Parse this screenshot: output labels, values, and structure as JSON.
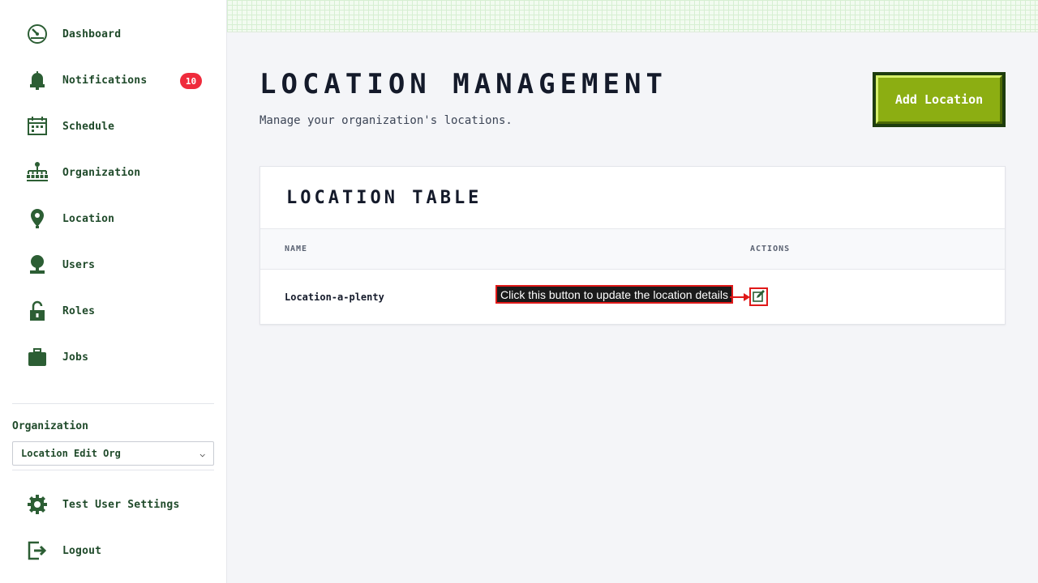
{
  "sidebar": {
    "nav": [
      {
        "label": "Dashboard",
        "icon": "dashboard-gauge-icon"
      },
      {
        "label": "Notifications",
        "icon": "bell-icon",
        "badge": "10"
      },
      {
        "label": "Schedule",
        "icon": "calendar-icon"
      },
      {
        "label": "Organization",
        "icon": "org-chart-icon"
      },
      {
        "label": "Location",
        "icon": "map-pin-icon"
      },
      {
        "label": "Users",
        "icon": "user-icon"
      },
      {
        "label": "Roles",
        "icon": "padlock-icon"
      },
      {
        "label": "Jobs",
        "icon": "briefcase-icon"
      }
    ],
    "organization_label": "Organization",
    "organization_selected": "Location Edit Org",
    "footer": [
      {
        "label": "Test User Settings",
        "icon": "gear-icon"
      },
      {
        "label": "Logout",
        "icon": "logout-icon"
      }
    ]
  },
  "main": {
    "title": "LOCATION MANAGEMENT",
    "subtitle": "Manage your organization's locations.",
    "add_button_label": "Add Location",
    "table": {
      "title": "LOCATION TABLE",
      "columns": [
        "NAME",
        "ACTIONS"
      ],
      "rows": [
        {
          "name": "Location-a-plenty",
          "action_icon": "edit-icon"
        }
      ]
    }
  },
  "annotation": {
    "text": "Click this button to update the location details"
  },
  "colors": {
    "nav_green": "#1f4a2a",
    "accent_green": "#8cae12",
    "badge_red": "#ef2b3c",
    "annotation_red": "#e01919"
  }
}
